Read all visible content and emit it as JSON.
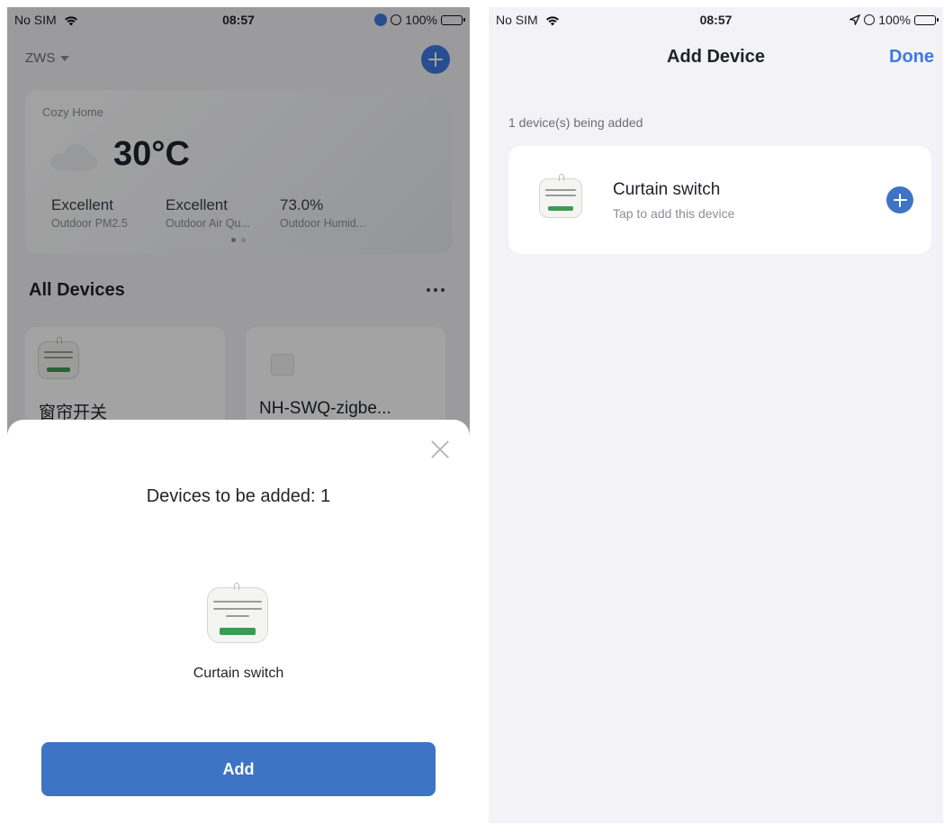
{
  "left_screen": {
    "status_bar": {
      "carrier": "No SIM",
      "time": "08:57",
      "battery": "100%"
    },
    "home": {
      "name": "ZWS"
    },
    "weather": {
      "place": "Cozy Home",
      "temperature": "30°C",
      "stats": [
        {
          "value": "Excellent",
          "label": "Outdoor PM2.5"
        },
        {
          "value": "Excellent",
          "label": "Outdoor Air Qu..."
        },
        {
          "value": "73.0%",
          "label": "Outdoor Humid..."
        }
      ]
    },
    "devices_section": {
      "title": "All Devices"
    },
    "devices": [
      {
        "name": "窗帘开关"
      },
      {
        "name": "NH-SWQ-zigbe..."
      }
    ],
    "sheet": {
      "title": "Devices to be added: 1",
      "device_name": "Curtain switch",
      "add_label": "Add"
    }
  },
  "right_screen": {
    "status_bar": {
      "carrier": "No SIM",
      "time": "08:57",
      "battery": "100%"
    },
    "nav": {
      "title": "Add Device",
      "done_label": "Done"
    },
    "section_note": "1 device(s) being added",
    "device": {
      "name": "Curtain switch",
      "subtitle": "Tap to add this device"
    }
  },
  "colors": {
    "accent": "#3e7ae2",
    "button": "#3e74c4",
    "terminal_green": "#3b9b55"
  },
  "icons": [
    "wifi-icon",
    "location-icon",
    "alarm-icon",
    "battery-icon",
    "add-icon",
    "caret-down-icon",
    "cloud-icon",
    "more-icon",
    "close-icon"
  ]
}
